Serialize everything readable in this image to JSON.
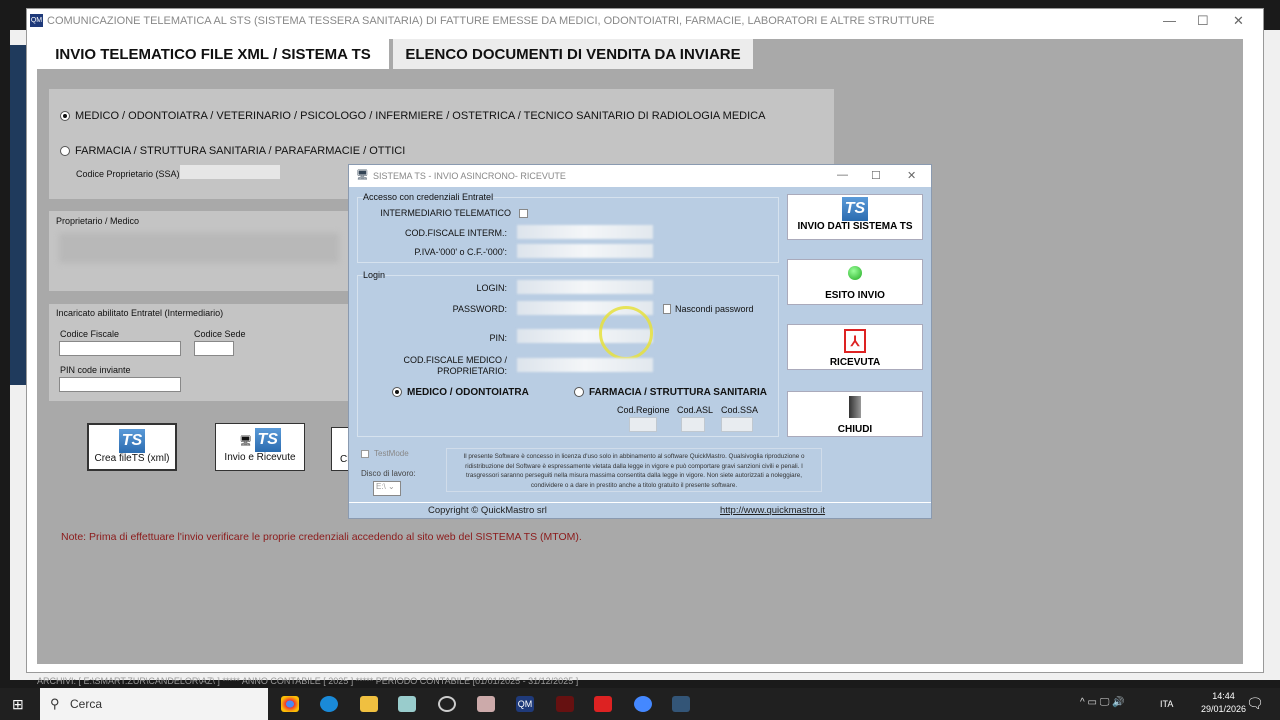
{
  "main_window": {
    "title": "COMUNICAZIONE TELEMATICA AL STS (SISTEMA TESSERA SANITARIA) DI FATTURE EMESSE DA MEDICI, ODONTOIATRI, FARMACIE, LABORATORI E ALTRE STRUTTURE",
    "icon_text": "QM"
  },
  "tabs": [
    {
      "label": "INVIO TELEMATICO FILE XML / SISTEMA TS",
      "active": true
    },
    {
      "label": "ELENCO DOCUMENTI DI VENDITA DA INVIARE",
      "active": false
    }
  ],
  "type_options": [
    {
      "label": "MEDICO / ODONTOIATRA / VETERINARIO / PSICOLOGO / INFERMIERE / OSTETRICA / TECNICO SANITARIO DI RADIOLOGIA MEDICA",
      "selected": true
    },
    {
      "label": "FARMACIA / STRUTTURA SANITARIA / PARAFARMACIE / OTTICI",
      "selected": false
    }
  ],
  "codice_proprietario_label": "Codice Proprietario (SSA):",
  "proprietario_label": "Proprietario / Medico",
  "incaricato": {
    "title": "Incaricato abilitato Entratel (Intermediario)",
    "codice_fiscale": "Codice Fiscale",
    "codice_sede": "Codice Sede",
    "pin": "PIN code inviante"
  },
  "actions": [
    {
      "label": "Crea fileTS (xml)"
    },
    {
      "label": "Invio e Ricevute"
    },
    {
      "label": "Ch"
    }
  ],
  "note": "Note: Prima di effettuare l'invio verificare le proprie credenziali accedendo al sito web del SISTEMA TS (MTOM).",
  "status_bar": "ARCHIVI: [ E:\\SMART.ZUR\\CANDELOR\\AZ\\ ] ***** ANNO CONTABILE [ 2025 ] ***** PERIODO CONTABILE [01/01/2025 - 31/12/2025 ]",
  "dialog": {
    "title": "SISTEMA TS - INVIO ASINCRONO- RICEVUTE",
    "entratel_group": "Accesso con credenziali Entratel",
    "intermediario": "INTERMEDIARIO TELEMATICO",
    "cf_interm": "COD.FISCALE INTERM.:",
    "piva": "P.IVA-'000' o C.F.-'000':",
    "login_group": "Login",
    "login": "LOGIN:",
    "password": "PASSWORD:",
    "nascondi": "Nascondi password",
    "pin": "PIN:",
    "cf_medico": "COD.FISCALE MEDICO / PROPRIETARIO:",
    "radio_medico": "MEDICO / ODONTOIATRA",
    "radio_farmacia": "FARMACIA / STRUTTURA SANITARIA",
    "cod_regione": "Cod.Regione",
    "cod_asl": "Cod.ASL",
    "cod_ssa": "Cod.SSA",
    "testmode": "TestMode",
    "disco_label": "Disco di lavoro:",
    "disco_value": "E:\\",
    "license": "Il presente Software è concesso in licenza d'uso solo in abbinamento al software QuickMastro. Qualsivoglia riproduzione o ridistribuzione del Software è espressamente vietata dalla legge in vigore e può comportare gravi sanzioni civili e penali. I trasgressori saranno perseguiti nella misura massima consentita dalla legge in vigore. Non siete autorizzati a noleggiare, condividere o a dare in prestito anche a titolo gratuito il presente software.",
    "copyright": "Copyright © QuickMastro srl",
    "website": "http://www.quickmastro.it",
    "buttons": [
      {
        "label": "INVIO DATI SISTEMA TS",
        "icon": "ts-logo-icon"
      },
      {
        "label": "ESITO INVIO",
        "icon": "green-led-icon"
      },
      {
        "label": "RICEVUTA",
        "icon": "pdf-icon"
      },
      {
        "label": "CHIUDI",
        "icon": "door-icon"
      }
    ]
  },
  "taskbar": {
    "search": "Cerca",
    "lang": "ITA",
    "time": "14:44",
    "date": "29/01/2026"
  }
}
